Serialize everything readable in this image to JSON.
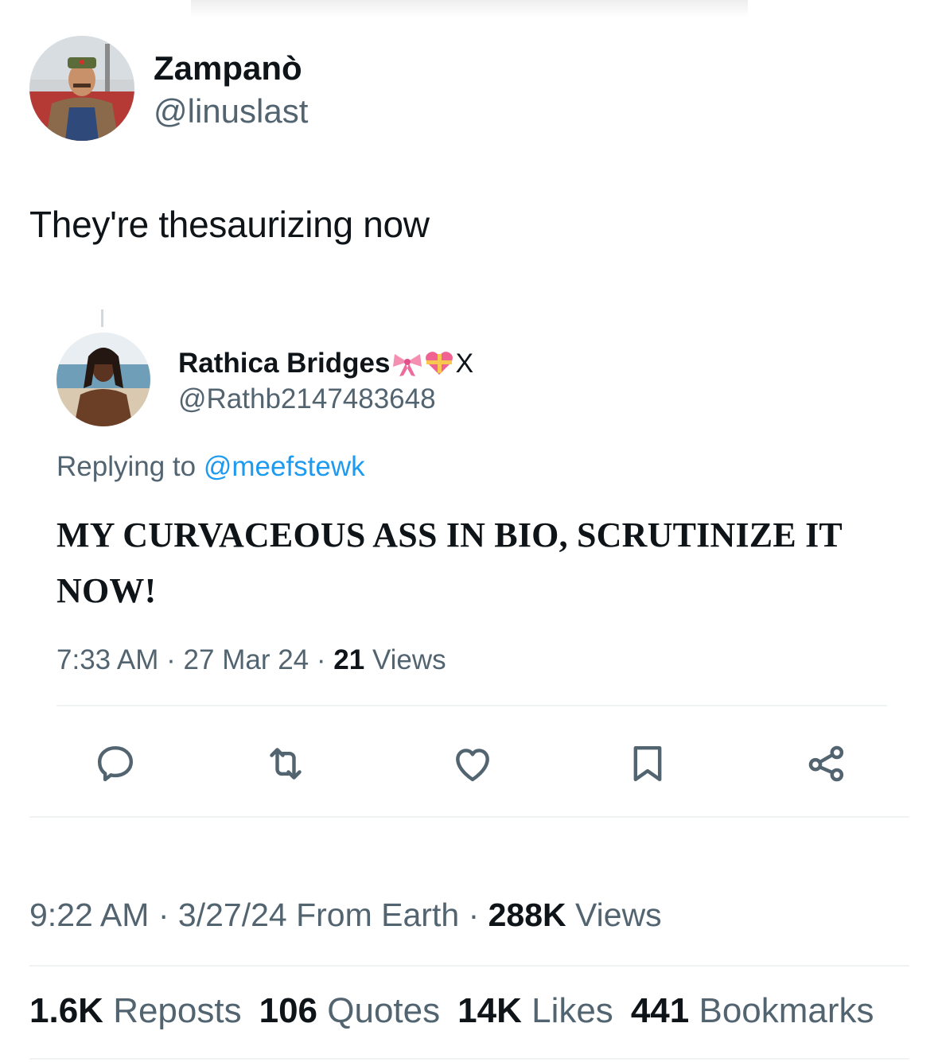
{
  "tweet": {
    "author_name": "Zampanò",
    "author_handle": "@linuslast",
    "text": "They're thesaurizing now",
    "time": "9:22 AM",
    "date": "3/27/24",
    "source": "From Earth",
    "views_count": "288K",
    "views_label": "Views",
    "separator": "·"
  },
  "quoted": {
    "author_name": "Rathica Bridges",
    "name_emojis": [
      "ribbon-emoji",
      "heart-with-ribbon-emoji"
    ],
    "name_suffix": "X",
    "author_handle": "@Rathb2147483648",
    "replying_prefix": "Replying to",
    "replying_to": "@meefstewk",
    "text": "MY CURVACEOUS ASS IN BIO, SCRUTINIZE IT NOW!",
    "time": "7:33 AM",
    "date": "27 Mar 24",
    "views_count": "21",
    "views_label": "Views",
    "actions": [
      "reply-icon",
      "retweet-icon",
      "like-icon",
      "bookmark-icon",
      "share-icon"
    ]
  },
  "stats": {
    "reposts_count": "1.6K",
    "reposts_label": "Reposts",
    "quotes_count": "106",
    "quotes_label": "Quotes",
    "likes_count": "14K",
    "likes_label": "Likes",
    "bookmarks_count": "441",
    "bookmarks_label": "Bookmarks"
  },
  "colors": {
    "text": "#0f1419",
    "secondary": "#536471",
    "link": "#1d9bf0",
    "divider": "#eff3f4",
    "icon": "#536471"
  }
}
